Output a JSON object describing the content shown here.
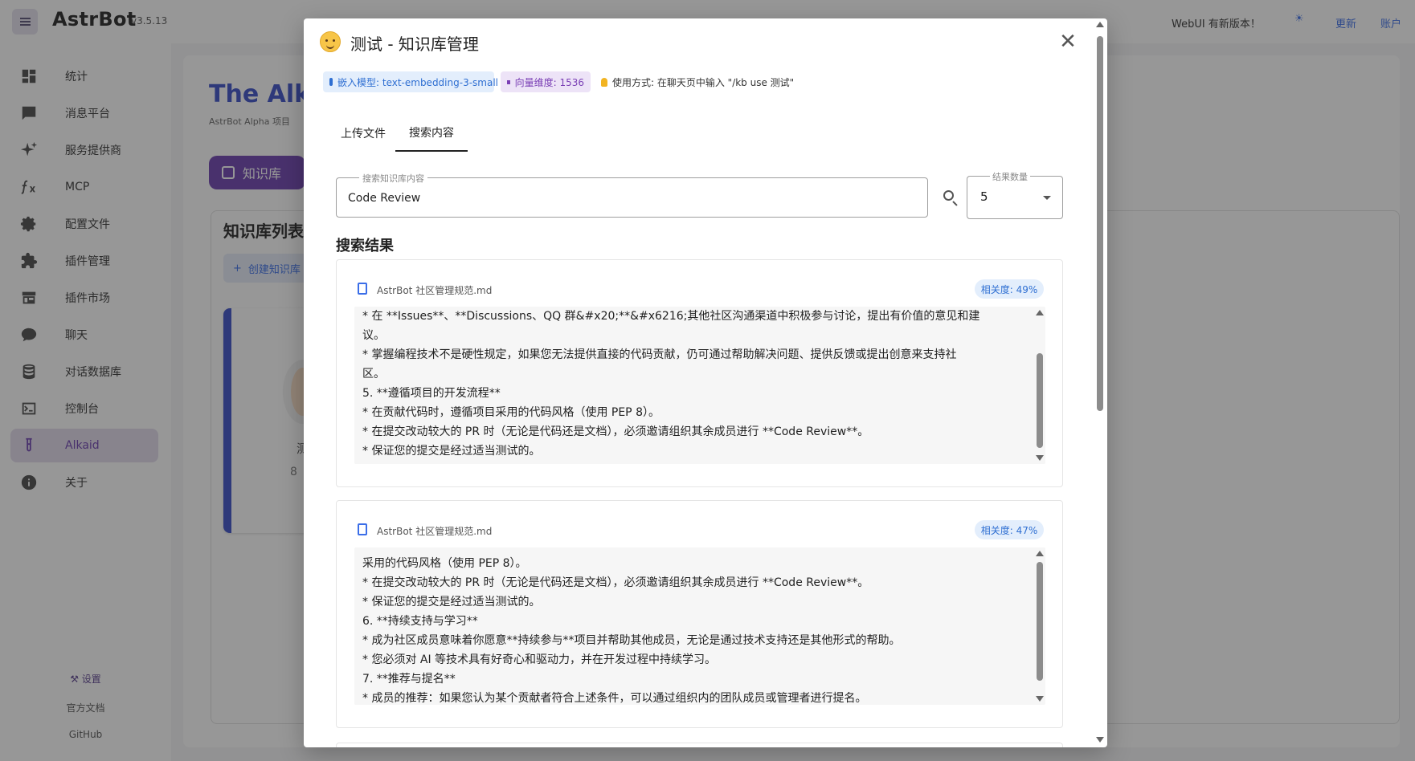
{
  "app": {
    "brand": "AstrBot",
    "version": "v3.5.13"
  },
  "topbar": {
    "update_note": "WebUI 有新版本！",
    "update_label": "更新",
    "account_label": "账户",
    "accent_color": "#3b6ee8"
  },
  "sidebar": {
    "items": [
      {
        "label": "统计",
        "icon": "dashboard-icon"
      },
      {
        "label": "消息平台",
        "icon": "message-icon"
      },
      {
        "label": "服务提供商",
        "icon": "sparkle-icon"
      },
      {
        "label": "MCP",
        "icon": "function-icon"
      },
      {
        "label": "配置文件",
        "icon": "gear-icon"
      },
      {
        "label": "插件管理",
        "icon": "puzzle-icon"
      },
      {
        "label": "插件市场",
        "icon": "store-icon"
      },
      {
        "label": "聊天",
        "icon": "chat-icon"
      },
      {
        "label": "对话数据库",
        "icon": "database-icon"
      },
      {
        "label": "控制台",
        "icon": "console-icon"
      },
      {
        "label": "Alkaid",
        "icon": "flask-icon",
        "active": true
      },
      {
        "label": "关于",
        "icon": "info-icon"
      }
    ],
    "settings_label": "设置",
    "docs_label": "官方文档",
    "github_label": "GitHub"
  },
  "background": {
    "title": "The Alkc",
    "subtitle": "AstrBot Alpha 项目",
    "kb_button": "知识库",
    "list_title": "知识库列表",
    "create_button": "创建知识库",
    "kb_count": "8",
    "kb_name": "测"
  },
  "dialog": {
    "title": "测试 - 知识库管理",
    "chips": {
      "embedding": "嵌入模型: text-embedding-3-small",
      "dimension": "向量维度: 1536",
      "usage": "使用方式: 在聊天页中输入 \"/kb use 测试\""
    },
    "tabs": {
      "upload": "上传文件",
      "search": "搜索内容"
    },
    "search": {
      "label": "搜索知识库内容",
      "value": "Code Review",
      "count_label": "结果数量",
      "count_value": "5"
    },
    "results_title": "搜索结果",
    "results": [
      {
        "file": "AstrBot 社区管理规范.md",
        "relevance": "相关度: 49%",
        "lines": [
          "* 在 **Issues**、**Discussions、QQ 群&#x20;**&#x6216;其他社区沟通渠道中积极参与讨论，提出有价值的意见和建",
          "议。",
          "* 掌握编程技术不是硬性规定，如果您无法提供直接的代码贡献，仍可通过帮助解决问题、提供反馈或提出创意来支持社",
          "区。",
          "5. **遵循项目的开发流程**",
          "* 在贡献代码时，遵循项目采用的代码风格（使用 PEP 8）。",
          "* 在提交改动较大的 PR 时（无论是代码还是文档），必须邀请组织其余成员进行 **Code Review**。",
          "* 保证您的提交是经过适当测试的。"
        ]
      },
      {
        "file": "AstrBot 社区管理规范.md",
        "relevance": "相关度: 47%",
        "lines": [
          "采用的代码风格（使用 PEP 8）。",
          "* 在提交改动较大的 PR 时（无论是代码还是文档），必须邀请组织其余成员进行 **Code Review**。",
          "* 保证您的提交是经过适当测试的。",
          "6. **持续支持与学习**",
          "* 成为社区成员意味着你愿意**持续参与**项目并帮助其他成员，无论是通过技术支持还是其他形式的帮助。",
          "* 您必须对 AI 等技术具有好奇心和驱动力，并在开发过程中持续学习。",
          "7. **推荐与提名**",
          "* 成员的推荐：如果您认为某个贡献者符合上述条件，可以通过组织内的团队成员或管理者进行提名。"
        ]
      }
    ]
  }
}
